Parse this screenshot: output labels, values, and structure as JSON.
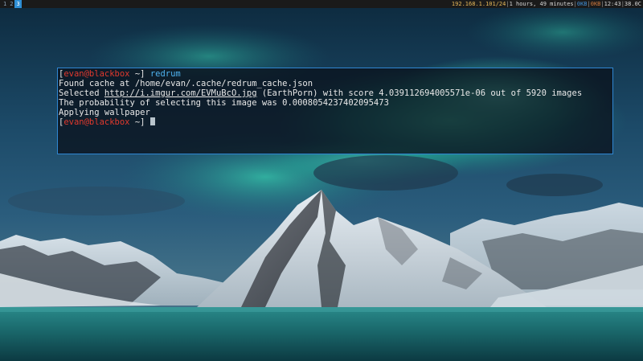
{
  "topbar": {
    "workspaces": [
      {
        "label": "1",
        "active": false
      },
      {
        "label": "2",
        "active": false
      },
      {
        "label": "3",
        "active": true
      }
    ],
    "status": {
      "ip": "192.168.1.101/24",
      "uptime": "1 hours, 49 minutes",
      "down": "0KB",
      "up": "0KB",
      "time": "12:43",
      "temp": "38.0C"
    }
  },
  "terminal": {
    "prompt_user": "evan@blackbox",
    "prompt_dir": "~",
    "command": "redrum",
    "output": {
      "cache_line": "Found cache at /home/evan/.cache/redrum_cache.json",
      "selected_prefix": "Selected ",
      "selected_link": "http://i.imgur.com/EVMuBcO.jpg",
      "selected_suffix": " (EarthPorn) with score 4.039112694005571e-06 out of 5920 images",
      "probability_line": "The probability of selecting this image was 0.00080542374020954​73",
      "applying_line": "Applying wallpaper"
    }
  },
  "colors": {
    "accent": "#2f86d2",
    "prompt_user": "#e0392e",
    "command": "#4fb3f0"
  }
}
